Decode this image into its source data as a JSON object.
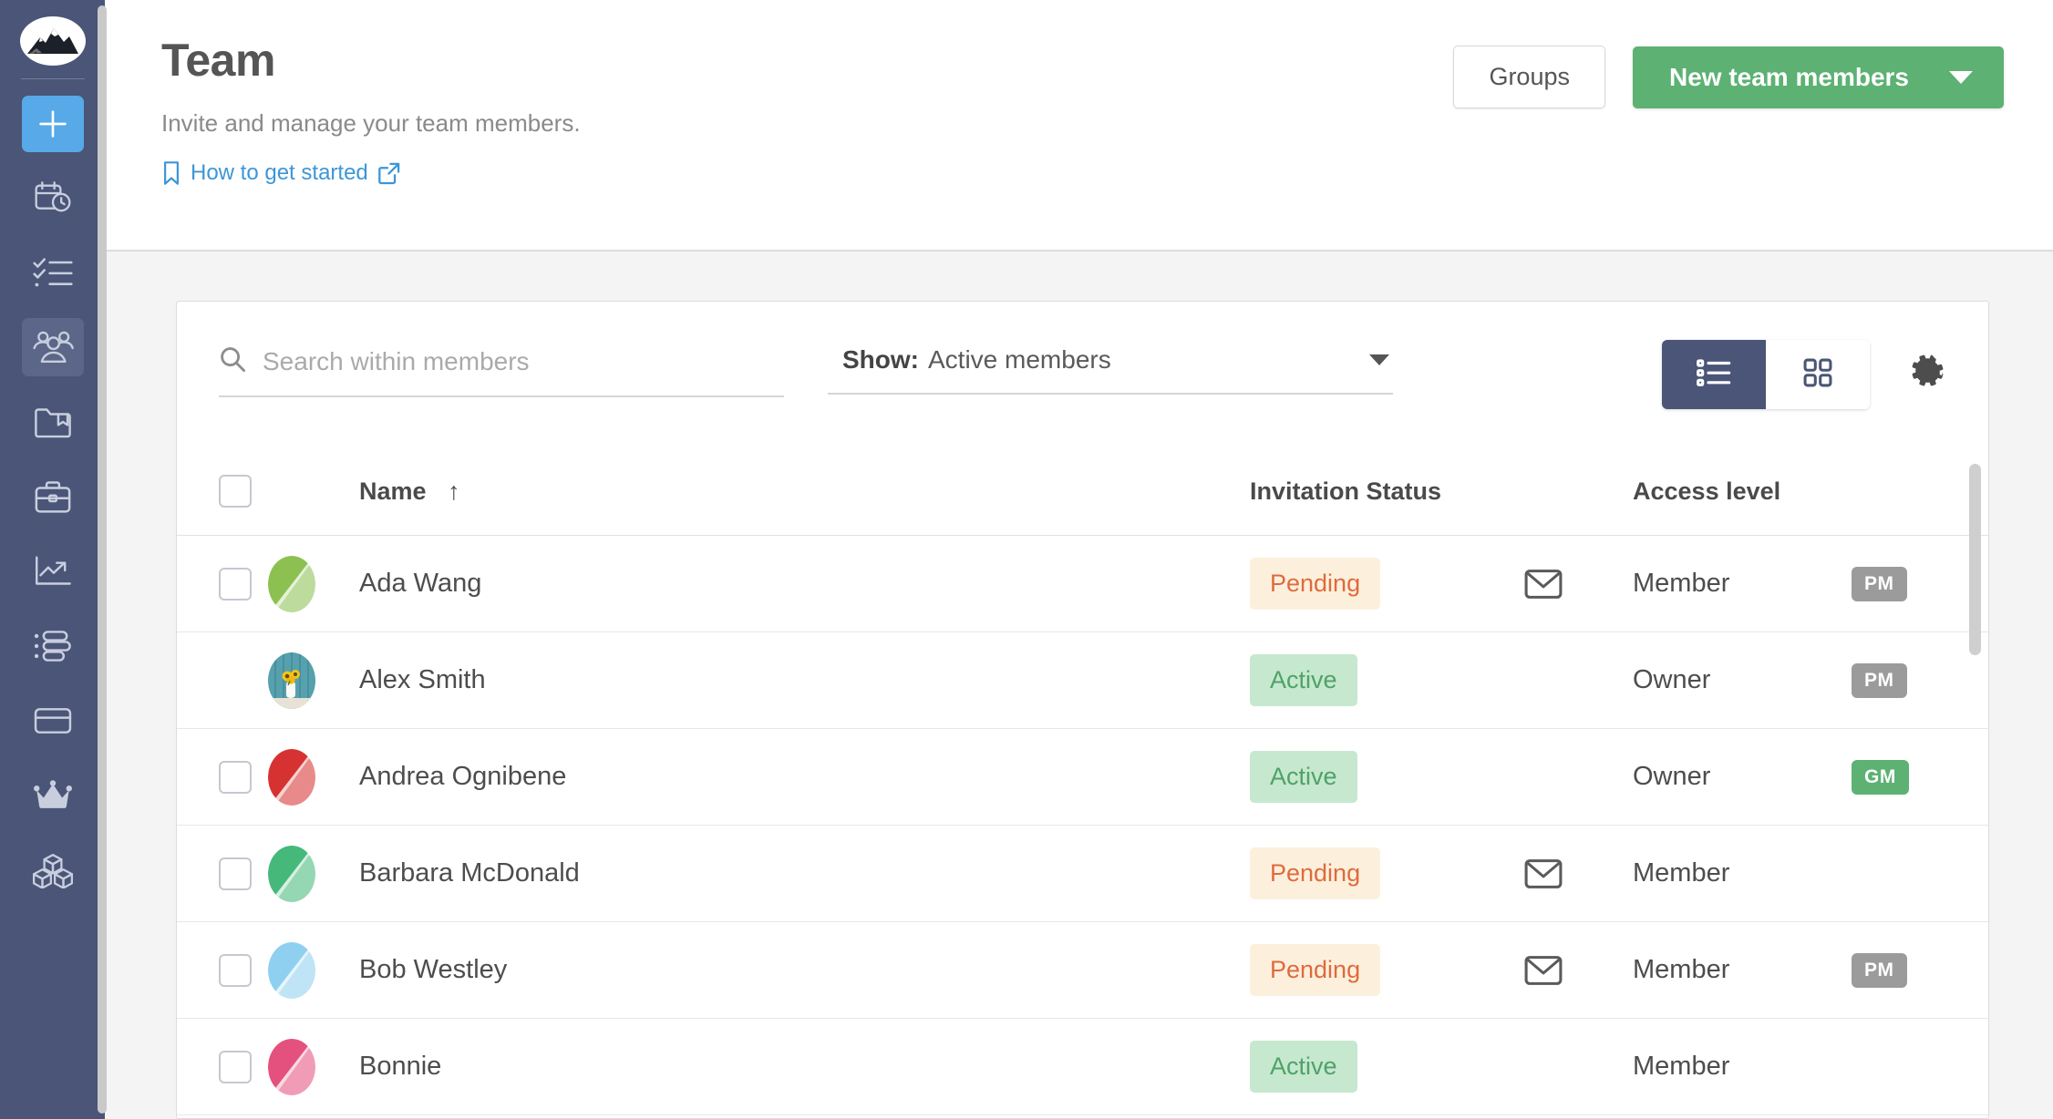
{
  "sidebar": {
    "logo_name": "mountain-logo",
    "items": [
      {
        "icon": "plus-icon",
        "name": "add-new",
        "state": "accent"
      },
      {
        "icon": "calendar-clock-icon",
        "name": "schedule",
        "state": "normal"
      },
      {
        "icon": "checklist-icon",
        "name": "tasks",
        "state": "normal"
      },
      {
        "icon": "people-icon",
        "name": "team",
        "state": "active"
      },
      {
        "icon": "folder-bookmark-icon",
        "name": "projects",
        "state": "normal"
      },
      {
        "icon": "briefcase-icon",
        "name": "portfolio",
        "state": "normal"
      },
      {
        "icon": "chart-up-icon",
        "name": "reports",
        "state": "normal"
      },
      {
        "icon": "list-settings-icon",
        "name": "workload",
        "state": "normal"
      },
      {
        "icon": "wallet-icon",
        "name": "budget",
        "state": "normal"
      },
      {
        "icon": "crown-icon",
        "name": "upgrade",
        "state": "normal"
      },
      {
        "icon": "cubes-icon",
        "name": "apps",
        "state": "normal"
      }
    ]
  },
  "header": {
    "title": "Team",
    "subtitle": "Invite and manage your team members.",
    "get_started_label": "How to get started",
    "groups_label": "Groups",
    "new_members_label": "New team members"
  },
  "toolbar": {
    "search_placeholder": "Search within members",
    "search_value": "",
    "show_label": "Show:",
    "show_value": "Active members",
    "show_options": [
      "Active members"
    ],
    "view_list_selected": true,
    "view_grid_selected": false
  },
  "table": {
    "columns": {
      "name": "Name",
      "sort_indicator": "↑",
      "invitation_status": "Invitation Status",
      "access_level": "Access level"
    },
    "rows": [
      {
        "name": "Ada Wang",
        "has_checkbox": true,
        "checked": false,
        "avatar_type": "gradient",
        "avatar_color": "#8cc152",
        "status": "Pending",
        "status_kind": "pending",
        "show_mail": true,
        "access": "Member",
        "badge": "PM",
        "badge_kind": "pm"
      },
      {
        "name": "Alex Smith",
        "has_checkbox": false,
        "checked": false,
        "avatar_type": "photo",
        "avatar_color": "#4a9cb0",
        "status": "Active",
        "status_kind": "active",
        "show_mail": false,
        "access": "Owner",
        "badge": "PM",
        "badge_kind": "pm"
      },
      {
        "name": "Andrea Ognibene",
        "has_checkbox": true,
        "checked": false,
        "avatar_type": "gradient",
        "avatar_color": "#d73232",
        "status": "Active",
        "status_kind": "active",
        "show_mail": false,
        "access": "Owner",
        "badge": "GM",
        "badge_kind": "gm"
      },
      {
        "name": "Barbara McDonald",
        "has_checkbox": true,
        "checked": false,
        "avatar_type": "gradient",
        "avatar_color": "#46b97a",
        "status": "Pending",
        "status_kind": "pending",
        "show_mail": true,
        "access": "Member",
        "badge": "",
        "badge_kind": ""
      },
      {
        "name": "Bob Westley",
        "has_checkbox": true,
        "checked": false,
        "avatar_type": "gradient",
        "avatar_color": "#8fd0f0",
        "status": "Pending",
        "status_kind": "pending",
        "show_mail": true,
        "access": "Member",
        "badge": "PM",
        "badge_kind": "pm"
      },
      {
        "name": "Bonnie",
        "has_checkbox": true,
        "checked": false,
        "avatar_type": "gradient",
        "avatar_color": "#e4517e",
        "status": "Active",
        "status_kind": "active",
        "show_mail": false,
        "access": "Member",
        "badge": "",
        "badge_kind": ""
      }
    ]
  },
  "colors": {
    "sidebar_bg": "#4a5578",
    "accent_blue": "#57a9e8",
    "link_blue": "#3d96d8",
    "primary_green": "#5cb173",
    "pending_bg": "#fcf0dd",
    "pending_fg": "#e06a3d",
    "active_bg": "#c6e8cf",
    "active_fg": "#4fa268",
    "page_bg": "#f4f4f4"
  }
}
